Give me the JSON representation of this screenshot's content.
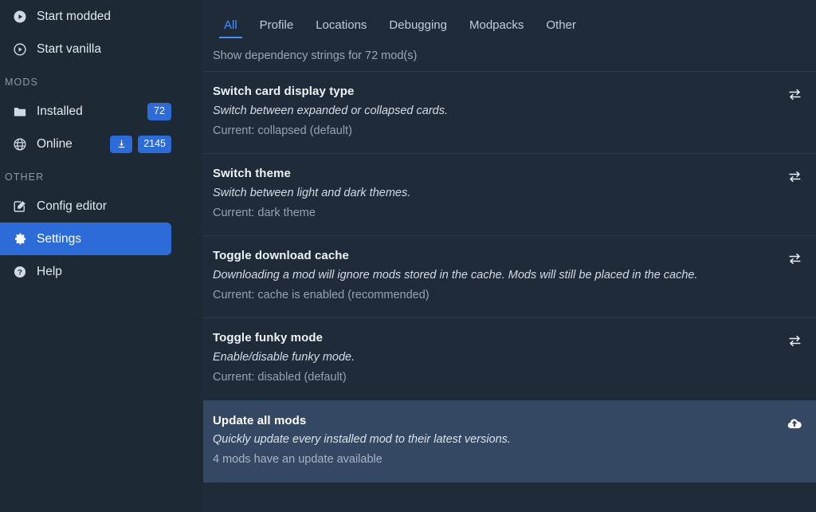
{
  "sidebar": {
    "launch_items": [
      {
        "label": "Start modded",
        "icon": "play-circle-filled-icon"
      },
      {
        "label": "Start vanilla",
        "icon": "play-circle-outline-icon"
      }
    ],
    "mods_section_label": "MODS",
    "mods_items": [
      {
        "label": "Installed",
        "icon": "folder-icon",
        "badge": "72",
        "download_badge": false
      },
      {
        "label": "Online",
        "icon": "globe-icon",
        "badge": "2145",
        "download_badge": true
      }
    ],
    "other_section_label": "OTHER",
    "other_items": [
      {
        "label": "Config editor",
        "icon": "edit-square-icon",
        "active": false
      },
      {
        "label": "Settings",
        "icon": "gear-icon",
        "active": true
      },
      {
        "label": "Help",
        "icon": "question-circle-icon",
        "active": false
      }
    ]
  },
  "tabs": [
    {
      "label": "All",
      "active": true
    },
    {
      "label": "Profile",
      "active": false
    },
    {
      "label": "Locations",
      "active": false
    },
    {
      "label": "Debugging",
      "active": false
    },
    {
      "label": "Modpacks",
      "active": false
    },
    {
      "label": "Other",
      "active": false
    }
  ],
  "clipped_row": {
    "status": "Show dependency strings for 72 mod(s)"
  },
  "settings_rows": [
    {
      "title": "Switch card display type",
      "description": "Switch between expanded or collapsed cards.",
      "status": "Current: collapsed (default)",
      "action_icon": "swap-horizontal-icon",
      "highlight": false
    },
    {
      "title": "Switch theme",
      "description": "Switch between light and dark themes.",
      "status": "Current: dark theme",
      "action_icon": "swap-horizontal-icon",
      "highlight": false
    },
    {
      "title": "Toggle download cache",
      "description": "Downloading a mod will ignore mods stored in the cache. Mods will still be placed in the cache.",
      "status": "Current: cache is enabled (recommended)",
      "action_icon": "swap-horizontal-icon",
      "highlight": false
    },
    {
      "title": "Toggle funky mode",
      "description": "Enable/disable funky mode.",
      "status": "Current: disabled (default)",
      "action_icon": "swap-horizontal-icon",
      "highlight": false
    },
    {
      "title": "Update all mods",
      "description": "Quickly update every installed mod to their latest versions.",
      "status": "4 mods have an update available",
      "action_icon": "cloud-upload-icon",
      "highlight": true
    }
  ],
  "colors": {
    "accent": "#2c6cd8",
    "tab_active": "#4c8ef7",
    "sidebar_bg": "#1d2935",
    "main_bg": "#1f2b38",
    "row_highlight": "#344863",
    "divider": "#2a3a4a"
  }
}
